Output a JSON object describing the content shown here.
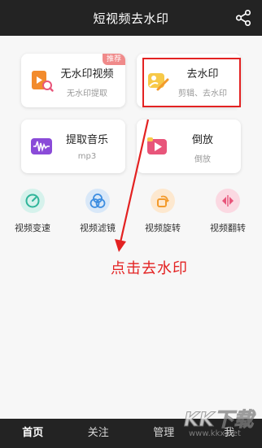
{
  "header": {
    "title": "短视频去水印",
    "share_icon": "share-icon"
  },
  "cards": {
    "no_watermark": {
      "title": "无水印视频",
      "subtitle": "无水印提取",
      "badge": "推荐",
      "icon": "video-search-icon"
    },
    "remove_watermark": {
      "title": "去水印",
      "subtitle": "剪辑、去水印",
      "icon": "eraser-icon"
    },
    "extract_music": {
      "title": "提取音乐",
      "subtitle": "mp3",
      "icon": "waveform-icon"
    },
    "reverse": {
      "title": "倒放",
      "subtitle": "倒放",
      "icon": "play-reverse-icon"
    }
  },
  "tools": [
    {
      "label": "视频变速",
      "icon": "speed-gauge-icon",
      "color": "#2fb59a"
    },
    {
      "label": "视频滤镜",
      "icon": "filter-icon",
      "color": "#3d8de0"
    },
    {
      "label": "视频旋转",
      "icon": "rotate-icon",
      "color": "#f39a2b"
    },
    {
      "label": "视频翻转",
      "icon": "flip-icon",
      "color": "#e8557a"
    }
  ],
  "annotation": {
    "text": "点击去水印",
    "color": "#e32222"
  },
  "bottom_nav": {
    "home": "首页",
    "follow": "关注",
    "manage": "管理",
    "me": "我"
  },
  "watermark": {
    "brand": "KK下载",
    "url": "www.kkx.net"
  }
}
